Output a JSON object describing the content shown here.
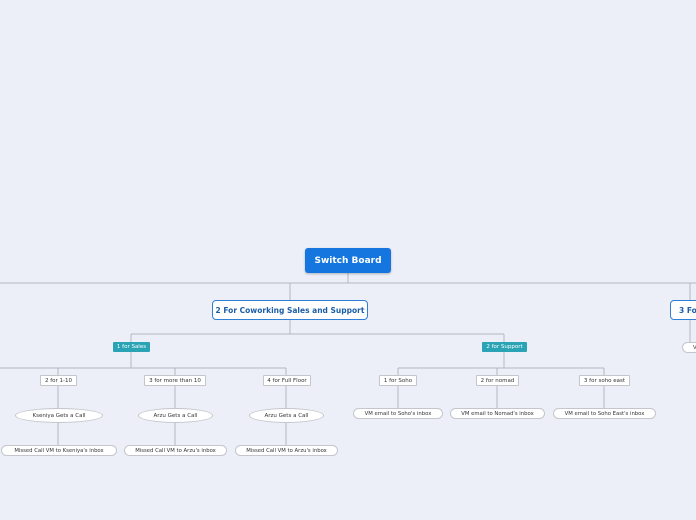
{
  "root": {
    "label": "Switch Board"
  },
  "option2": {
    "label": "2 For Coworking Sales and Support",
    "sales": {
      "label": "1 for Sales",
      "items": [
        {
          "key": "2 for 1-10",
          "call": "Kseniya Gets a Call",
          "missed": "Missed Call VM to Kseniya's inbox"
        },
        {
          "key": "3 for more than 10",
          "call": "Arzu Gets a Call",
          "missed": "Missed Call VM to Arzu's inbox"
        },
        {
          "key": "4 for Full Floor",
          "call": "Arzu Gets a Call",
          "missed": "Missed Call VM to Arzu's inbox"
        }
      ]
    },
    "support": {
      "label": "2 for Support",
      "items": [
        {
          "key": "1 for Soho",
          "vm": "VM email to Soho's inbox"
        },
        {
          "key": "2 for nomad",
          "vm": "VM email to Nomad's inbox"
        },
        {
          "key": "3 for soho east",
          "vm": "VM email to Soho East's inbox"
        }
      ]
    }
  },
  "option3": {
    "label_visible": "3 Fo",
    "child_visible": "V"
  },
  "colors": {
    "background": "#eceef8",
    "root": "#1576e0",
    "accent_border": "#2f7fd6",
    "teal": "#2aa4b5",
    "connector": "#b3b6c0"
  }
}
